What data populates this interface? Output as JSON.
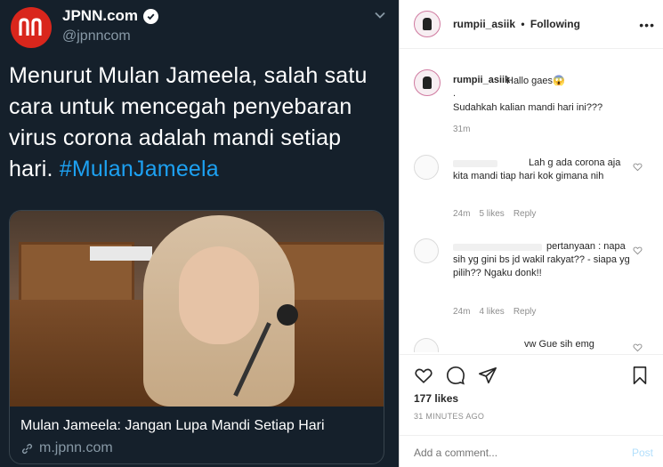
{
  "tweet": {
    "name": "JPNN.com",
    "handle": "@jpnncom",
    "text": "Menurut Mulan Jameela, salah satu cara untuk mencegah penyebaran virus corona adalah mandi setiap hari.",
    "hashtag": "#MulanJameela",
    "card_title": "Mulan Jameela: Jangan Lupa Mandi Setiap Hari",
    "card_link": "m.jpnn.com",
    "watermark": "jpnn.com",
    "colors": {
      "background": "#15202b",
      "hashtag": "#1da1f2",
      "avatar": "#d9261c"
    }
  },
  "instagram": {
    "username": "rumpii_asiik",
    "separator": "•",
    "follow_status": "Following",
    "more": "•••",
    "caption": {
      "user": "rumpii_asiik",
      "line1": "Hallo gaes😱",
      "dot": ".",
      "line2": "Sudahkah kalian mandi hari ini???",
      "time": "31m"
    },
    "comments": [
      {
        "text": "Lah g ada corona aja kita mandi tiap hari kok gimana nih",
        "time": "24m",
        "likes": "5 likes",
        "reply": "Reply"
      },
      {
        "text": "pertanyaan : napa sih yg gini bs jd wakil rakyat?? - siapa yg pilih?? Ngaku donk!!",
        "time": "24m",
        "likes": "4 likes",
        "reply": "Reply"
      },
      {
        "text": "vw Gue sih emg",
        "time": "",
        "likes": "",
        "reply": ""
      }
    ],
    "likes_count": "177 likes",
    "posted": "31 MINUTES AGO",
    "add_comment_placeholder": "Add a comment...",
    "post_label": "Post"
  }
}
